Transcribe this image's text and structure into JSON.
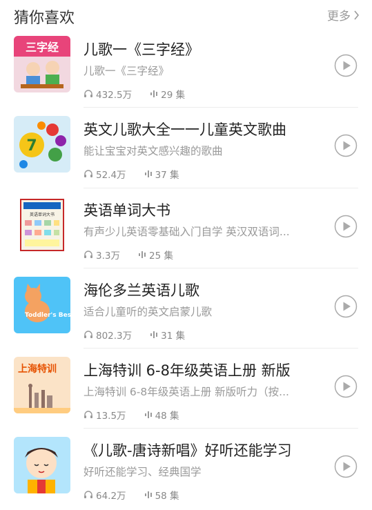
{
  "header": {
    "title": "猜你喜欢",
    "more_label": "更多"
  },
  "items": [
    {
      "title": "儿歌一《三字经》",
      "subtitle": "儿歌一《三字经》",
      "plays": "432.5万",
      "episodes": "29 集",
      "thumb_text": "三字经"
    },
    {
      "title": "英文儿歌大全一一儿童英文歌曲",
      "subtitle": "能让宝宝对英文感兴趣的歌曲",
      "plays": "52.4万",
      "episodes": "37 集",
      "thumb_text": "7"
    },
    {
      "title": "英语单词大书",
      "subtitle": "有声少儿英语零基础入门自学 英汉双语词...",
      "plays": "3.3万",
      "episodes": "25 集",
      "thumb_text": "英语单词大书"
    },
    {
      "title": "海伦多兰英语儿歌",
      "subtitle": "适合儿童听的英文启蒙儿歌",
      "plays": "802.3万",
      "episodes": "31 集",
      "thumb_text": "Toddler's Best Start"
    },
    {
      "title": "上海特训 6-8年级英语上册 新版",
      "subtitle": "上海特训 6-8年级英语上册 新版听力（按...",
      "plays": "13.5万",
      "episodes": "48 集",
      "thumb_text": "上海特训"
    },
    {
      "title": "《儿歌-唐诗新唱》好听还能学习",
      "subtitle": "好听还能学习、经典国学",
      "plays": "64.2万",
      "episodes": "58 集",
      "thumb_text": ""
    }
  ],
  "colors": {
    "accent_play": "#aaaaaa",
    "text_primary": "#222222",
    "text_secondary": "#999999"
  }
}
